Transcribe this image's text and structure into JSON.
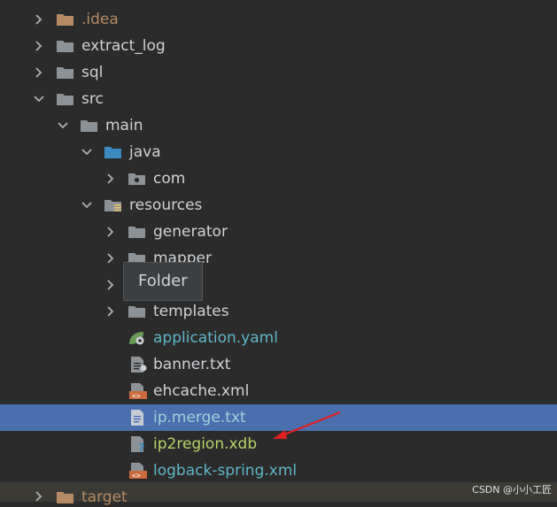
{
  "tree": {
    "idea": ".idea",
    "extract_log": "extract_log",
    "sql": "sql",
    "src": "src",
    "main": "main",
    "java": "java",
    "com": "com",
    "resources": "resources",
    "generator": "generator",
    "mapper": "mapper",
    "templates": "templates",
    "application": "application.yaml",
    "banner": "banner.txt",
    "ehcache": "ehcache.xml",
    "ipmerge": "ip.merge.txt",
    "ip2region": "ip2region.xdb",
    "logback": "logback-spring.xml",
    "target": "target"
  },
  "tooltip": "Folder",
  "watermark": "CSDN @小小工匠",
  "colors": {
    "background": "#2b2b2b",
    "selection": "#4b6eaf",
    "excluded_folder": "#b48b63",
    "source_folder": "#3b8bc2",
    "resource_file_text": "#5fb6c8",
    "unknown_file_text": "#b9d36a",
    "annotation_arrow": "#e02020"
  }
}
